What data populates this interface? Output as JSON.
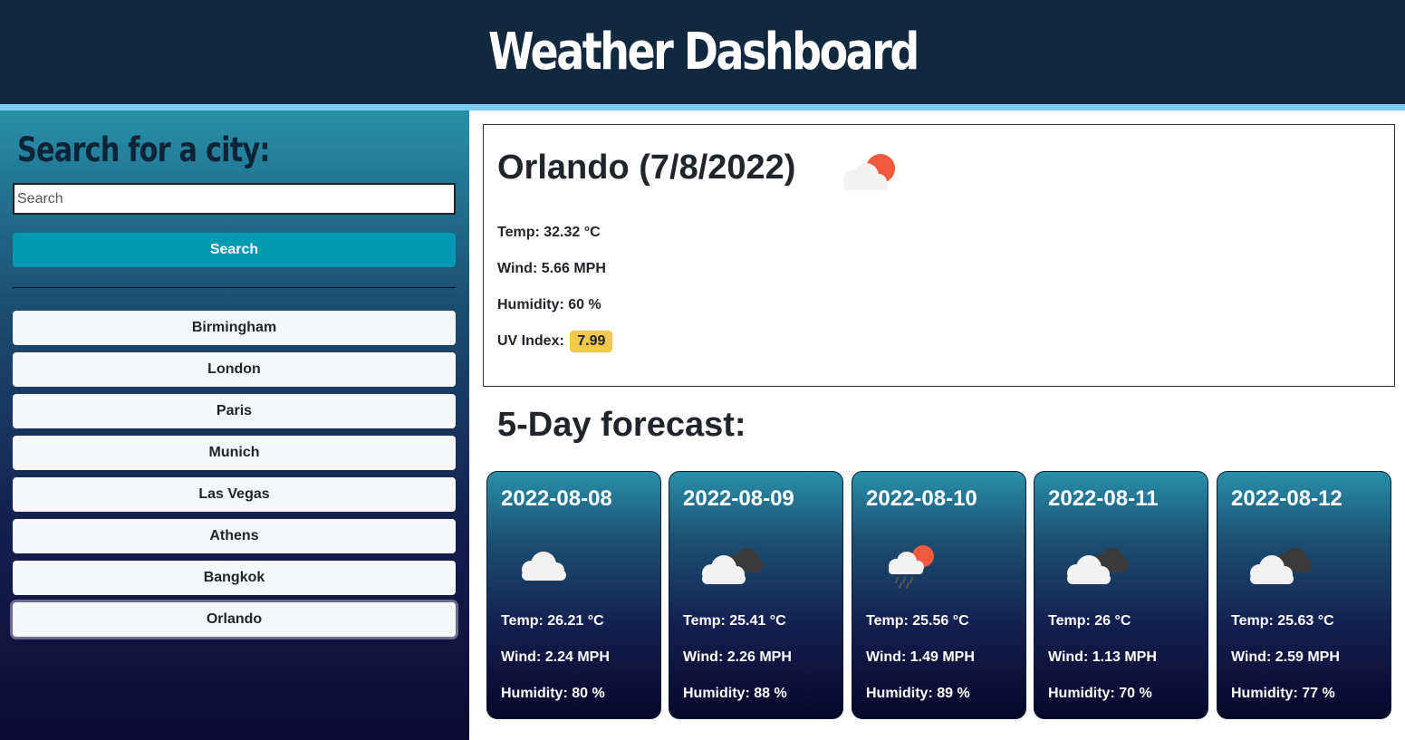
{
  "header": {
    "title": "Weather Dashboard"
  },
  "sidebar": {
    "title": "Search for a city:",
    "search_placeholder": "Search",
    "search_button": "Search",
    "history": [
      "Birmingham",
      "London",
      "Paris",
      "Munich",
      "Las Vegas",
      "Athens",
      "Bangkok",
      "Orlando"
    ]
  },
  "today": {
    "heading": "Orlando (7/8/2022)",
    "icon": "cloud-sun-icon",
    "temp": "Temp: 32.32 °C",
    "wind": "Wind: 5.66 MPH",
    "humidity": "Humidity: 60 %",
    "uv_label": "UV Index:",
    "uv_value": "7.99",
    "uv_color": "#f3c94c"
  },
  "forecast": {
    "title": "5-Day forecast:",
    "days": [
      {
        "date": "2022-08-08",
        "icon": "cloud-icon",
        "temp": "Temp: 26.21 °C",
        "wind": "Wind: 2.24 MPH",
        "humidity": "Humidity: 80 %"
      },
      {
        "date": "2022-08-09",
        "icon": "overcast-cloud-icon",
        "temp": "Temp: 25.41 °C",
        "wind": "Wind: 2.26 MPH",
        "humidity": "Humidity: 88 %"
      },
      {
        "date": "2022-08-10",
        "icon": "rain-sun-icon",
        "temp": "Temp: 25.56 °C",
        "wind": "Wind: 1.49 MPH",
        "humidity": "Humidity: 89 %"
      },
      {
        "date": "2022-08-11",
        "icon": "overcast-cloud-icon",
        "temp": "Temp: 26 °C",
        "wind": "Wind: 1.13 MPH",
        "humidity": "Humidity: 70 %"
      },
      {
        "date": "2022-08-12",
        "icon": "overcast-cloud-icon",
        "temp": "Temp: 25.63 °C",
        "wind": "Wind: 2.59 MPH",
        "humidity": "Humidity: 77 %"
      }
    ]
  }
}
